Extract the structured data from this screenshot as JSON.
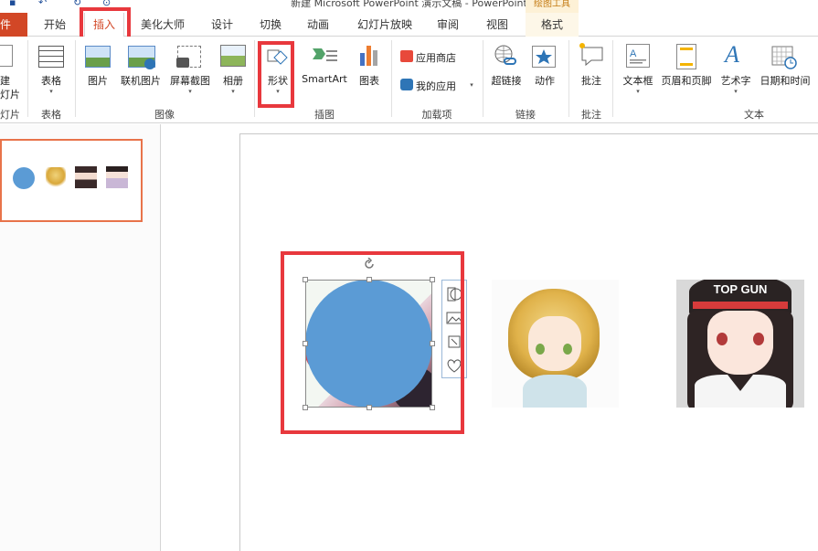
{
  "window": {
    "title": "新建 Microsoft PowerPoint 演示文稿 - PowerPoint"
  },
  "context_tab_group": "绘图工具",
  "tabs": [
    {
      "id": "file",
      "label": "文件",
      "visible_label": "件"
    },
    {
      "id": "home",
      "label": "开始"
    },
    {
      "id": "insert",
      "label": "插入",
      "active": true
    },
    {
      "id": "meihua",
      "label": "美化大师"
    },
    {
      "id": "design",
      "label": "设计"
    },
    {
      "id": "transitions",
      "label": "切换"
    },
    {
      "id": "animations",
      "label": "动画"
    },
    {
      "id": "slideshow",
      "label": "幻灯片放映"
    },
    {
      "id": "review",
      "label": "审阅"
    },
    {
      "id": "view",
      "label": "视图"
    },
    {
      "id": "format",
      "label": "格式"
    }
  ],
  "ribbon": {
    "groups": {
      "slides": "灯片",
      "tables": "表格",
      "images": "图像",
      "illustrations": "插图",
      "addins": "加载项",
      "links": "链接",
      "comments": "批注",
      "text": "文本"
    },
    "buttons": {
      "new_slide": "建",
      "new_slide_2": "灯片",
      "table": "表格",
      "picture": "图片",
      "online_picture": "联机图片",
      "screenshot": "屏幕截图",
      "album": "相册",
      "shapes": "形状",
      "smartart": "SmartArt",
      "chart": "图表",
      "app_store": "应用商店",
      "my_apps": "我的应用",
      "hyperlink": "超链接",
      "action": "动作",
      "comment": "批注",
      "textbox": "文本框",
      "header_footer": "页眉和页脚",
      "wordart": "艺术字",
      "datetime": "日期和时间"
    },
    "dropdown_arrow": "▾"
  },
  "slide": {
    "images": [
      {
        "name": "image-girl-cap",
        "cap_text": "TOP GUN"
      }
    ]
  },
  "colors": {
    "accent_red": "#e8383d",
    "file_tab": "#d24726",
    "shape_fill": "#5b9bd5",
    "thumb_border": "#e8734a"
  }
}
